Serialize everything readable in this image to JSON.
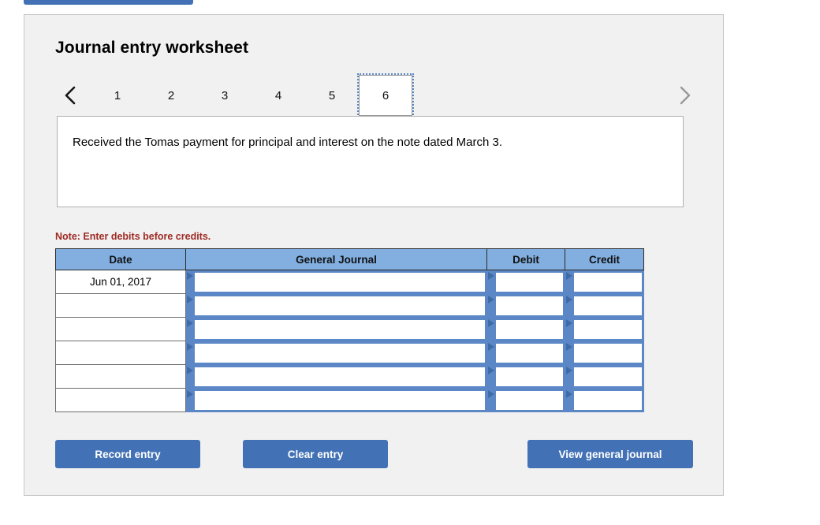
{
  "top_partial_button": {
    "label": ""
  },
  "panel": {
    "title": "Journal entry worksheet"
  },
  "pager": {
    "prev_icon": "chevron-left-icon",
    "next_icon": "chevron-right-icon",
    "tabs": [
      "1",
      "2",
      "3",
      "4",
      "5",
      "6"
    ],
    "selected_tab": "6"
  },
  "description": {
    "text": "Received the Tomas payment for principal and interest on the note dated March 3."
  },
  "note": {
    "text": "Note: Enter debits before credits."
  },
  "table": {
    "columns": [
      "Date",
      "General Journal",
      "Debit",
      "Credit"
    ],
    "rows": [
      {
        "date": "Jun 01, 2017",
        "general_journal": "",
        "debit": "",
        "credit": ""
      },
      {
        "date": "",
        "general_journal": "",
        "debit": "",
        "credit": ""
      },
      {
        "date": "",
        "general_journal": "",
        "debit": "",
        "credit": ""
      },
      {
        "date": "",
        "general_journal": "",
        "debit": "",
        "credit": ""
      },
      {
        "date": "",
        "general_journal": "",
        "debit": "",
        "credit": ""
      },
      {
        "date": "",
        "general_journal": "",
        "debit": "",
        "credit": ""
      }
    ]
  },
  "buttons": {
    "record": "Record entry",
    "clear": "Clear entry",
    "view_journal": "View general journal"
  },
  "colors": {
    "button_blue": "#4271b5",
    "header_blue": "#82aee0",
    "input_border_blue": "#5b87c7",
    "note_red": "#9e2b25",
    "panel_bg": "#f1f1f1"
  }
}
